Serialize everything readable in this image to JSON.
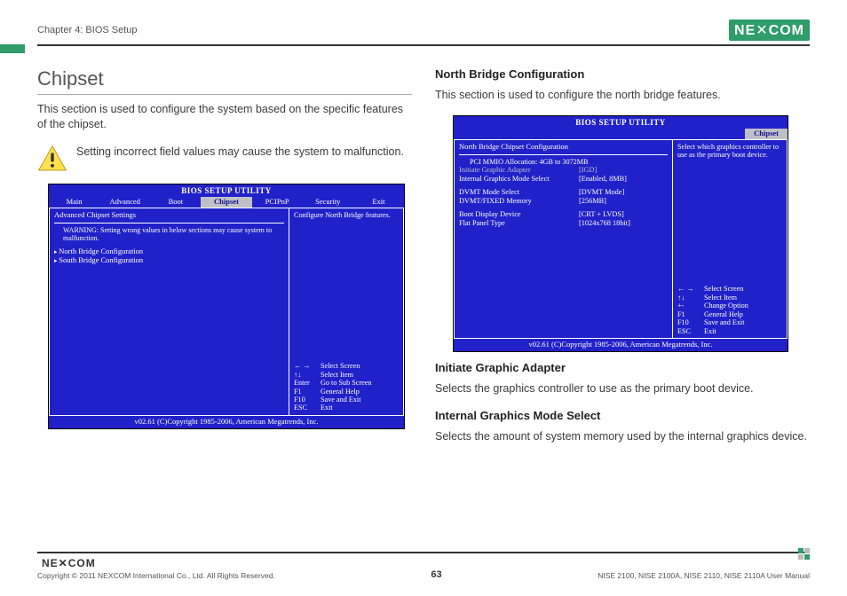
{
  "header": {
    "chapter": "Chapter 4: BIOS Setup",
    "brand_left": "NE",
    "brand_right": "COM"
  },
  "left": {
    "title": "Chipset",
    "intro": "This section is used to configure the system based on the specific features of the chipset.",
    "warning": "Setting incorrect field values may cause the system to malfunction."
  },
  "bios1": {
    "title": "BIOS SETUP UTILITY",
    "tabs": [
      "Main",
      "Advanced",
      "Boot",
      "Chipset",
      "PCIPnP",
      "Security",
      "Exit"
    ],
    "active_tab": "Chipset",
    "section": "Advanced Chipset Settings",
    "warn": "WARNING: Setting wrong values in below sections may cause system to malfunction.",
    "links": [
      "North Bridge Configuration",
      "South Bridge Configuration"
    ],
    "help_top": "Configure North Bridge features.",
    "keys": [
      [
        "← →",
        "Select Screen"
      ],
      [
        "↑↓",
        "Select Item"
      ],
      [
        "Enter",
        "Go to Sub Screen"
      ],
      [
        "F1",
        "General Help"
      ],
      [
        "F10",
        "Save and Exit"
      ],
      [
        "ESC",
        "Exit"
      ]
    ],
    "footer": "v02.61 (C)Copyright 1985-2006, American Megatrends, Inc."
  },
  "right": {
    "nb_title": "North Bridge Configuration",
    "nb_intro": "This section is used to configure the north bridge features.",
    "iga_title": "Initiate Graphic Adapter",
    "iga_text": "Selects the graphics controller to use as the primary boot device.",
    "igms_title": "Internal Graphics Mode Select",
    "igms_text": "Selects the amount of system memory used by the internal graphics device."
  },
  "bios2": {
    "title": "BIOS SETUP UTILITY",
    "tab": "Chipset",
    "section": "North Bridge Chipset Configuration",
    "alloc": "PCI MMIO Allocation: 4GB to 3072MB",
    "rows": [
      [
        "Initiate Graphic Adapter",
        "[IGD]",
        true
      ],
      [
        "Internal Graphics Mode Select",
        "[Enabled, 8MB]",
        false
      ],
      [
        "",
        "",
        false
      ],
      [
        "DVMT Mode Select",
        "[DVMT Mode]",
        false
      ],
      [
        "   DVMT/FIXED Memory",
        "[256MB]",
        false
      ],
      [
        "",
        "",
        false
      ],
      [
        "Boot Display Device",
        "[CRT + LVDS]",
        false
      ],
      [
        "Flat Panel Type",
        "[1024x768 18bit]",
        false
      ]
    ],
    "help_top": "Select which graphics controller to use as the primary boot device.",
    "keys": [
      [
        "← →",
        "Select Screen"
      ],
      [
        "↑↓",
        "Select Item"
      ],
      [
        "+-",
        "Change Option"
      ],
      [
        "F1",
        "General Help"
      ],
      [
        "F10",
        "Save and Exit"
      ],
      [
        "ESC",
        "Exit"
      ]
    ],
    "footer": "v02.61 (C)Copyright 1985-2006, American Megatrends, Inc."
  },
  "footer": {
    "copyright": "Copyright © 2011 NEXCOM International Co., Ltd. All Rights Reserved.",
    "page": "63",
    "product": "NISE 2100, NISE 2100A, NISE 2110, NISE 2110A User Manual"
  }
}
